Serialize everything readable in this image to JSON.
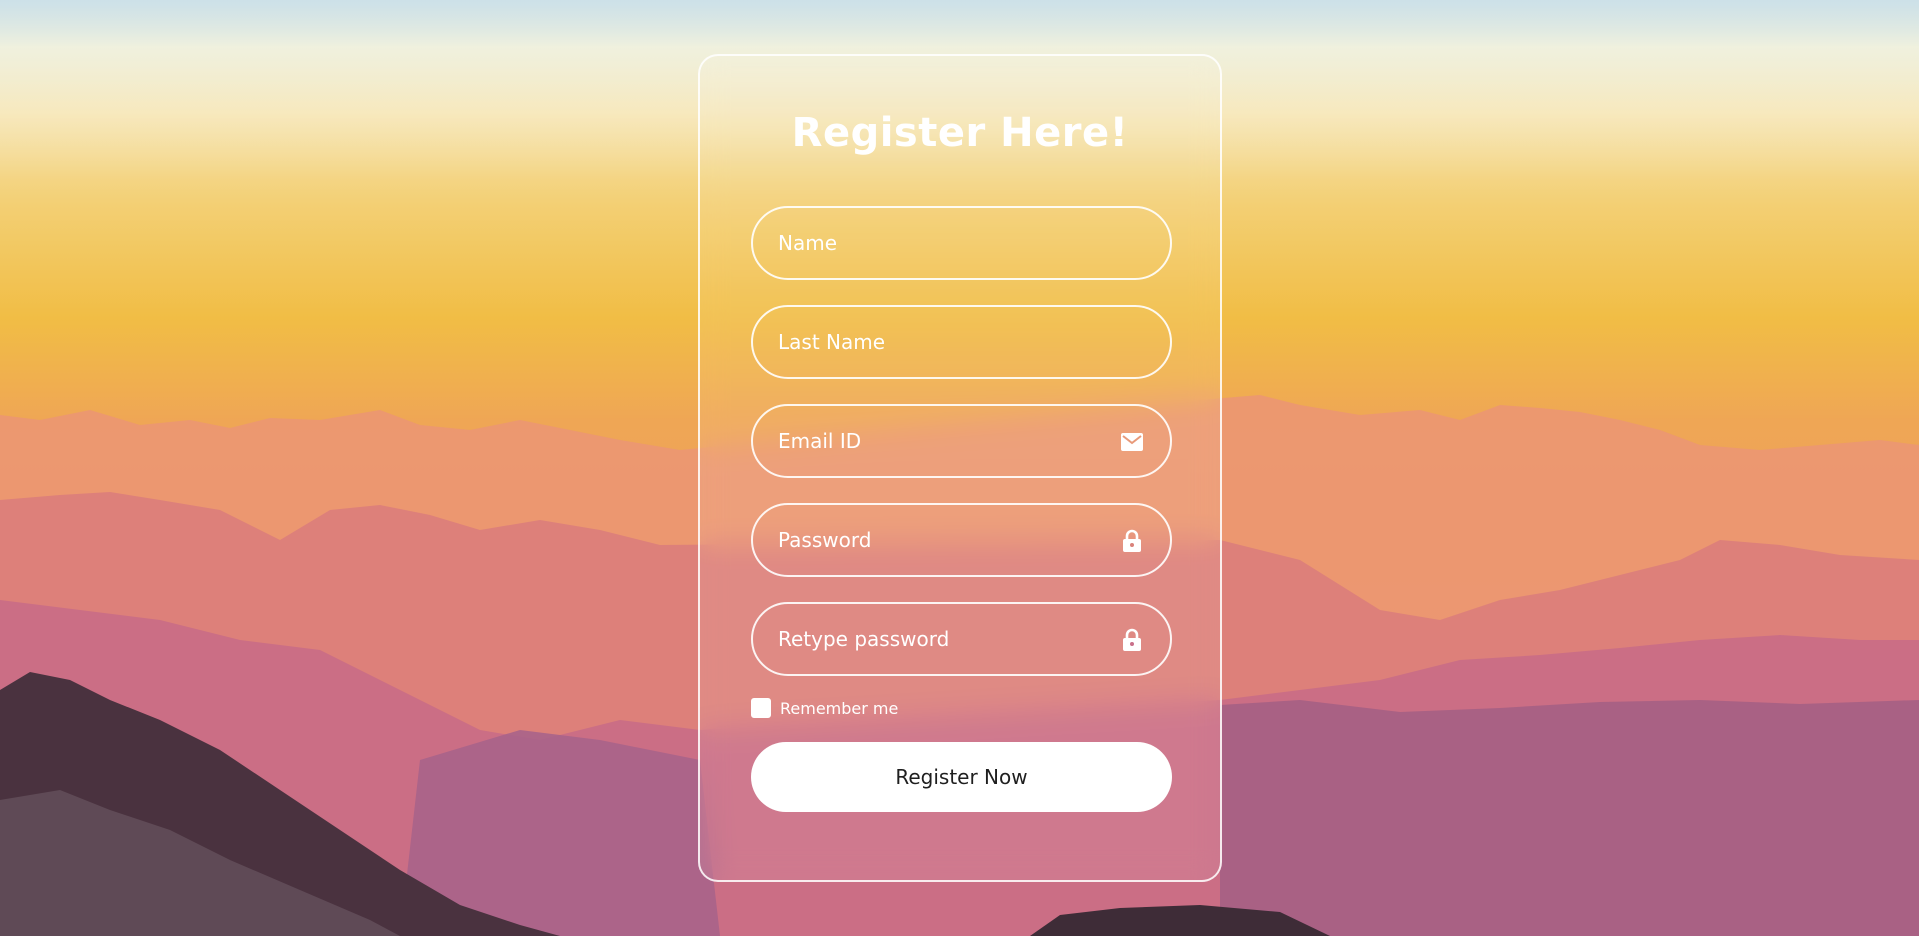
{
  "form": {
    "title": "Register Here!",
    "fields": [
      {
        "placeholder": "Name",
        "icon": ""
      },
      {
        "placeholder": "Last Name",
        "icon": ""
      },
      {
        "placeholder": "Email ID",
        "icon": "mail-icon"
      },
      {
        "placeholder": "Password",
        "icon": "lock-icon"
      },
      {
        "placeholder": "Retype password",
        "icon": "lock-icon"
      }
    ],
    "remember_label": "Remember me",
    "submit_label": "Register Now"
  },
  "colors": {
    "text": "#ffffff",
    "button_bg": "#ffffff",
    "button_text": "#1f1f1f"
  }
}
